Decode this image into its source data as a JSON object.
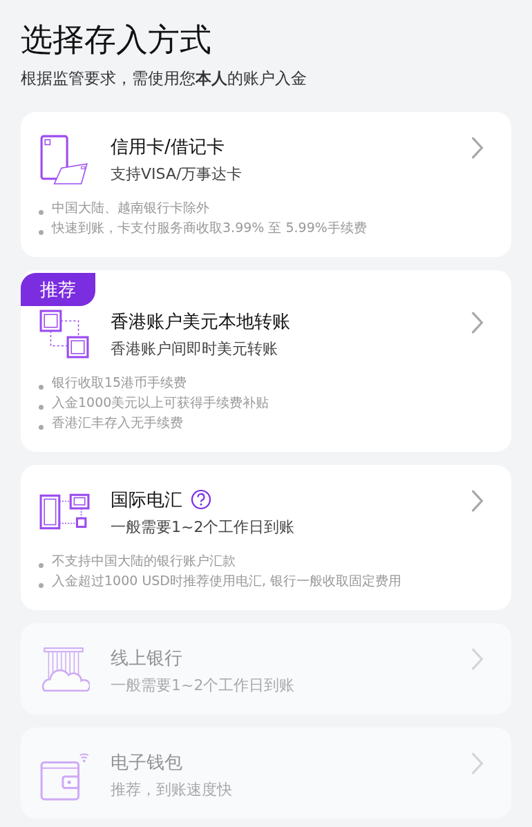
{
  "title": "选择存入方式",
  "subtitle": "根据监管要求，需使用您**本人**的账户入金",
  "methods": [
    {
      "kind": "card",
      "title": "信用卡/借记卡",
      "subtitle": "支持VISA/万事达卡",
      "disabled": false,
      "notes": [
        "中国大陆、越南银行卡除外",
        "快速到账，卡支付服务商收取3.99% 至 5.99%手续费"
      ]
    },
    {
      "kind": "transfer",
      "badge": "推荐",
      "title": "香港账户美元本地转账",
      "subtitle": "香港账户间即时美元转账",
      "disabled": false,
      "notes": [
        "银行收取15港币手续费",
        "入金1000美元以上可获得手续费补贴",
        "香港汇丰存入无手续费"
      ]
    },
    {
      "kind": "wire",
      "title": "国际电汇",
      "help": true,
      "subtitle": "一般需要1~2个工作日到账",
      "disabled": false,
      "notes": [
        "不支持中国大陆的银行账户汇款",
        "入金超过1000 USD时推荐使用电汇, 银行一般收取固定费用"
      ]
    },
    {
      "kind": "bank",
      "title": "线上银行",
      "subtitle": "一般需要1~2个工作日到账",
      "disabled": true
    },
    {
      "kind": "wallet",
      "title": "电子钱包",
      "subtitle": "推荐，到账速度快",
      "disabled": true
    }
  ]
}
